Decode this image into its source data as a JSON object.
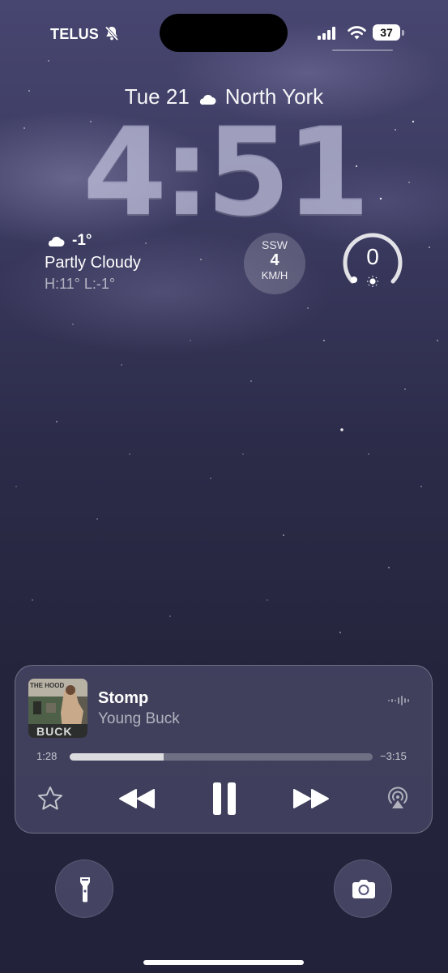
{
  "status_bar": {
    "carrier": "TELUS",
    "silent_mode_icon": "bell-slash-icon",
    "signal_icon": "cellular-signal-icon",
    "wifi_icon": "wifi-icon",
    "battery_level": "37"
  },
  "lock_screen": {
    "date": "Tue 21",
    "location_weather_icon": "partly-cloudy-night-icon",
    "location": "North York",
    "time": "4:51"
  },
  "widgets": {
    "weather": {
      "icon": "partly-cloudy-night-icon",
      "temperature": "-1°",
      "condition": "Partly Cloudy",
      "high_low": "H:11° L:-1°"
    },
    "wind": {
      "direction": "SSW",
      "speed": "4",
      "unit": "KM/H"
    },
    "uv_index": {
      "value": "0",
      "level_fraction": 0.0,
      "icon": "sun-icon"
    }
  },
  "now_playing": {
    "album_art_text": "THE HOOD",
    "album_art_artist_text": "BUCK",
    "title": "Stomp",
    "artist": "Young Buck",
    "elapsed": "1:28",
    "remaining": "−3:15",
    "progress_fraction": 0.31,
    "controls": [
      "star-icon",
      "rewind-icon",
      "pause-icon",
      "fast-forward-icon",
      "airplay-icon"
    ]
  },
  "quick_actions": {
    "left": "flashlight-icon",
    "right": "camera-icon"
  },
  "colors": {
    "background_top": "#474670",
    "background_bottom": "#22223a",
    "clock": "#cdcdeb"
  }
}
